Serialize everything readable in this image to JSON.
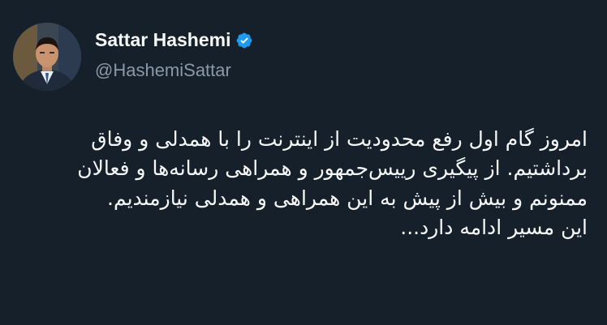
{
  "author": {
    "display_name": "Sattar Hashemi",
    "handle": "@HashemiSattar",
    "verified": true,
    "avatar_icon": "profile-photo",
    "verified_icon": "verified-badge-icon",
    "verified_color": "#1d9bf0"
  },
  "tweet": {
    "paragraph_1": "امروز گام اول رفع محدودیت از اینترنت را با همدلی و وفاق برداشتیم. از پیگیری رییس‌جمهور و همراهی رسانه‌ها و فعالان ممنونم و بیش از پیش به این همراهی و همدلی نیازمندیم.",
    "paragraph_2": "این مسیر ادامه دارد..."
  },
  "colors": {
    "background": "#15202b",
    "text": "#f7f9f9",
    "muted": "#8b98a5"
  }
}
